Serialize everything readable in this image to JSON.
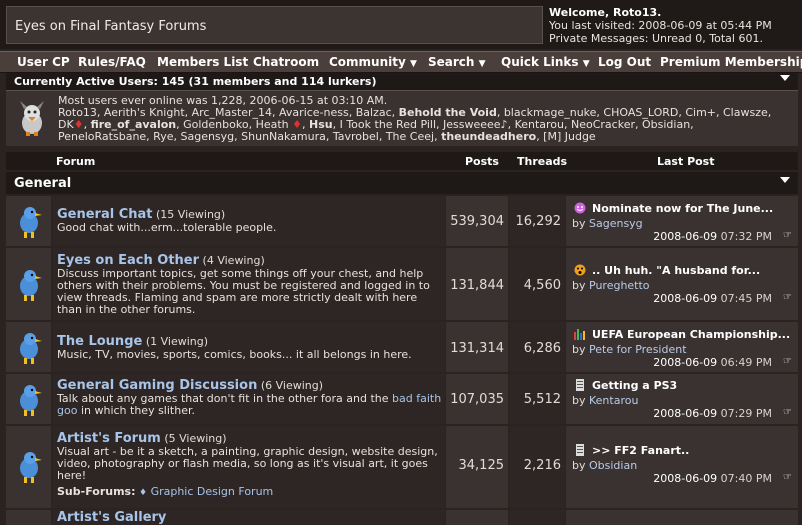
{
  "header": {
    "site_title": "Eyes on Final Fantasy Forums",
    "welcome": "Welcome, Roto13.",
    "last_visited": "You last visited: 2008-06-09 at 05:44 PM",
    "private_messages": "Private Messages: Unread 0, Total 601."
  },
  "nav": [
    {
      "label": "User CP",
      "dropdown": false
    },
    {
      "label": "Rules/FAQ",
      "dropdown": false
    },
    {
      "label": "Members List",
      "dropdown": false
    },
    {
      "label": "Chatroom",
      "dropdown": false
    },
    {
      "label": "Community",
      "dropdown": true
    },
    {
      "label": "Search",
      "dropdown": true
    },
    {
      "label": "Quick Links",
      "dropdown": true
    },
    {
      "label": "Log Out",
      "dropdown": false
    },
    {
      "label": "Premium Membership",
      "dropdown": false
    }
  ],
  "active_users": {
    "heading": "Currently Active Users: 145 (31 members and 114 lurkers)",
    "most_ever": "Most users ever online was 1,228, 2006-06-15 at 03:10 AM.",
    "line2_a": "Roto13, Aerith's Knight, Arc_Master_14, Avarice-ness, Balzac, ",
    "line2_b": "Behold the Void",
    "line2_c": ", blackmage_nuke, CHOAS_LORD, Cim+, Clawsze,",
    "line3_a": "DK",
    "line3_b": ", ",
    "line3_c": "fire_of_avalon",
    "line3_d": ", Goldenboko, Heath",
    "line3_e": ", ",
    "line3_f": "Hsu",
    "line3_g": ", I Took the Red Pill, Jessweeee",
    "line3_h": ", Kentarou, NeoCracker, Obsidian,",
    "line4_a": "PeneloRatsbane, Rye, Sagensyg, ShunNakamura, Tavrobel, The Ceej, ",
    "line4_b": "theundeadhero",
    "line4_c": ", [M] Judge"
  },
  "columns": {
    "forum": "Forum",
    "posts": "Posts",
    "threads": "Threads",
    "last_post": "Last Post"
  },
  "category": "General",
  "forums": [
    {
      "name": "General Chat",
      "viewing": "(15 Viewing)",
      "description": "Good chat with...erm...tolerable people.",
      "posts": "539,304",
      "threads": "16,292",
      "last_title": "Nominate now for The June...",
      "last_by": "by",
      "last_user": "Sagensyg",
      "last_date": "2008-06-09",
      "last_time": "07:32 PM",
      "icon": "smile-icon"
    },
    {
      "name": "Eyes on Each Other",
      "viewing": "(4 Viewing)",
      "description": "Discuss important topics, get some things off your chest, and help others with their problems. You must be registered and logged in to view threads. Flaming and spam are more strictly dealt with here than in the other forums.",
      "posts": "131,844",
      "threads": "4,560",
      "last_title": ".. Uh huh. \"A husband for...",
      "last_by": "by",
      "last_user": "Pureghetto",
      "last_date": "2008-06-09",
      "last_time": "07:45 PM",
      "icon": "surprised-icon"
    },
    {
      "name": "The Lounge",
      "viewing": "(1 Viewing)",
      "description": "Music, TV, movies, sports, comics, books... it all belongs in here.",
      "posts": "131,314",
      "threads": "6,286",
      "last_title": "UEFA European Championship...",
      "last_by": "by",
      "last_user": "Pete for President",
      "last_date": "2008-06-09",
      "last_time": "06:49 PM",
      "icon": "chart-icon"
    },
    {
      "name": "General Gaming Discussion",
      "viewing": "(6 Viewing)",
      "description_a": "Talk about any games that don't fit in the other fora and the ",
      "description_link": "bad faith goo",
      "description_b": " in which they slither.",
      "posts": "107,035",
      "threads": "5,512",
      "last_title": "Getting a PS3",
      "last_by": "by",
      "last_user": "Kentarou",
      "last_date": "2008-06-09",
      "last_time": "07:29 PM",
      "icon": "document-icon"
    },
    {
      "name": "Artist's Forum",
      "viewing": "(5 Viewing)",
      "description": "Visual art - be it a sketch, a painting, graphic design, website design, video, photography or flash media, so long as it's visual art, it goes here!",
      "subforums_label": "Sub-Forums:",
      "subforum": "Graphic Design Forum",
      "posts": "34,125",
      "threads": "2,216",
      "last_title": ">> FF2 Fanart..",
      "last_by": "by",
      "last_user": "Obsidian",
      "last_date": "2008-06-09",
      "last_time": "07:40 PM",
      "icon": "document-icon"
    },
    {
      "name": "Artist's Gallery"
    }
  ]
}
